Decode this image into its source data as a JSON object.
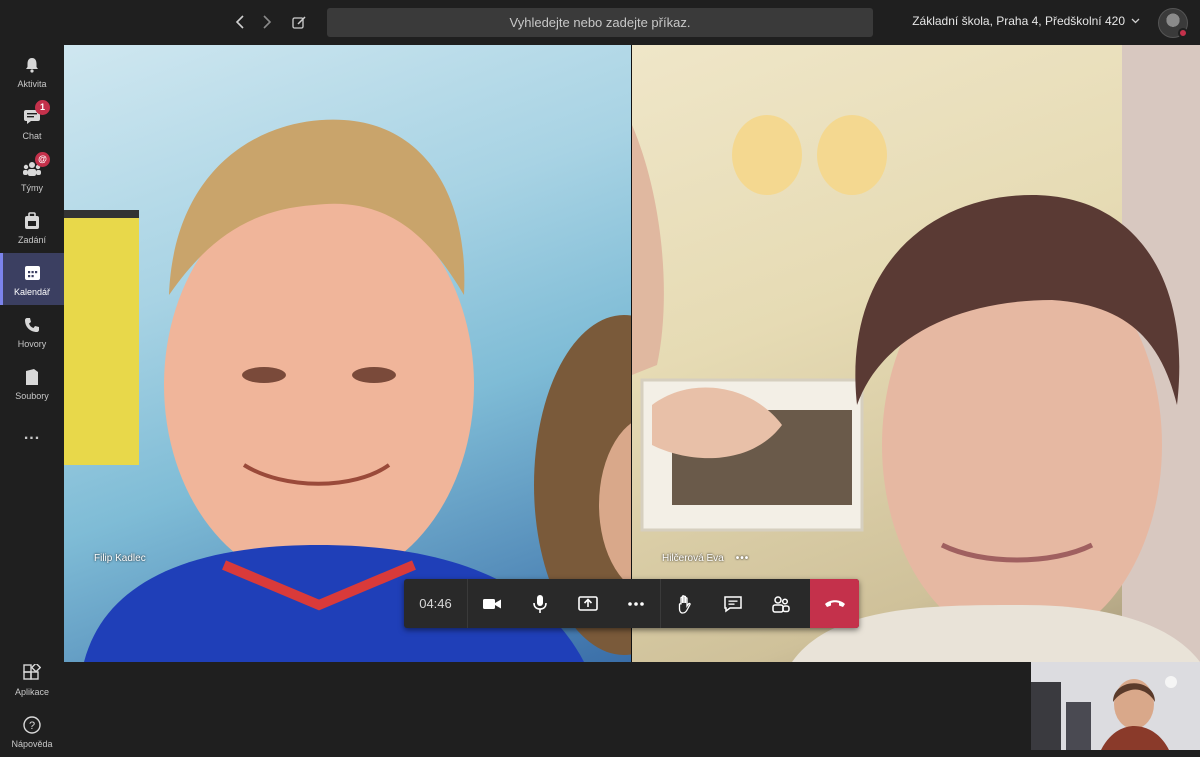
{
  "topbar": {
    "search_placeholder": "Vyhledejte nebo zadejte příkaz.",
    "org_name": "Základní škola, Praha 4, Předškolní 420",
    "back_icon": "chevron-left-icon",
    "forward_icon": "chevron-right-icon",
    "compose_icon": "compose-icon"
  },
  "rail": {
    "items": [
      {
        "label": "Aktivita",
        "icon": "bell-icon"
      },
      {
        "label": "Chat",
        "icon": "chat-icon",
        "badge": "1"
      },
      {
        "label": "Týmy",
        "icon": "teams-icon",
        "badge": "@"
      },
      {
        "label": "Zadání",
        "icon": "assignment-icon"
      },
      {
        "label": "Kalendář",
        "icon": "calendar-icon",
        "active": true
      },
      {
        "label": "Hovory",
        "icon": "phone-icon"
      },
      {
        "label": "Soubory",
        "icon": "file-icon"
      },
      {
        "label": "...",
        "icon": "more-icon"
      }
    ],
    "bottom": [
      {
        "label": "Aplikace",
        "icon": "apps-icon"
      },
      {
        "label": "Nápověda",
        "icon": "help-icon"
      }
    ]
  },
  "call": {
    "participants": [
      {
        "name": "Filip Kadlec"
      },
      {
        "name": "Hilčerová Eva"
      }
    ],
    "participant_more": "•••",
    "timer": "04:46"
  },
  "colors": {
    "accent": "#7b83eb",
    "hangup": "#c4314b",
    "rail_active": "#3b3f61"
  }
}
